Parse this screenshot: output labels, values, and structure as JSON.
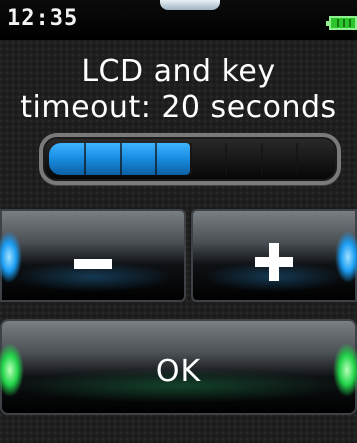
{
  "status_bar": {
    "time": "12:35",
    "battery_icon": "battery-full-icon"
  },
  "setting": {
    "title_line1": "LCD and key",
    "title_line2": "timeout: 20 seconds",
    "level_fraction": 0.5,
    "segments_total": 8
  },
  "controls": {
    "decrease_icon": "minus-icon",
    "increase_icon": "plus-icon",
    "ok_label": "OK"
  },
  "colors": {
    "accent_blue": "#1a8fe4",
    "accent_green": "#22d44a",
    "battery_green": "#2ec42e"
  }
}
